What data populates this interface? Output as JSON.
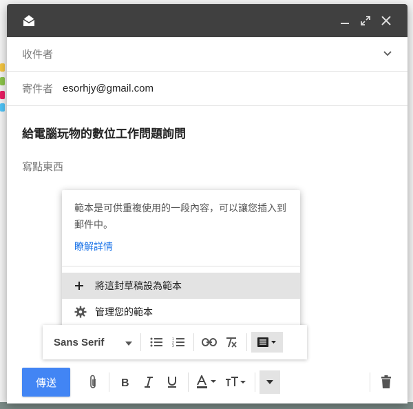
{
  "compose": {
    "recipients_placeholder": "收件者",
    "from_label": "寄件者",
    "from_value": "esorhjy@gmail.com",
    "subject": "給電腦玩物的數位工作問題詢問",
    "body_placeholder": "寫點東西"
  },
  "templates_popup": {
    "description": "範本是可供重複使用的一段內容，可以讓您插入到郵件中。",
    "learn_more": "瞭解詳情",
    "items": [
      {
        "label": "將這封草稿設為範本",
        "icon": "plus-icon"
      },
      {
        "label": "管理您的範本",
        "icon": "gear-icon"
      }
    ]
  },
  "format_toolbar": {
    "font": "Sans Serif"
  },
  "bottom_bar": {
    "send_label": "傳送"
  },
  "colors": {
    "titlebar": "#404040",
    "send": "#4285f4",
    "link": "#1a73e8",
    "highlight": "#e3e3e3"
  }
}
